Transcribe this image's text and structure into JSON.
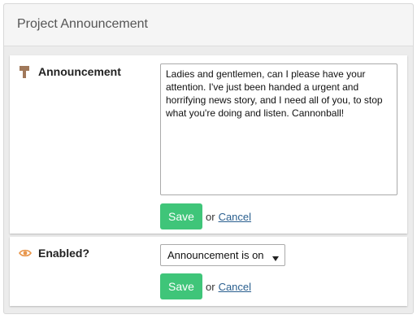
{
  "panel": {
    "title": "Project Announcement"
  },
  "announcement": {
    "label": "Announcement",
    "icon": "signpost-icon",
    "icon_color": "#a0785a",
    "value": "Ladies and gentlemen, can I please have your attention. I've just been handed a urgent and horrifying news story, and I need all of you, to stop what you're doing and listen. Cannonball!",
    "save_label": "Save",
    "or_text": "or",
    "cancel_label": "Cancel"
  },
  "enabled": {
    "label": "Enabled?",
    "icon": "eye-icon",
    "icon_color": "#e8954a",
    "selected": "Announcement is on",
    "save_label": "Save",
    "or_text": "or",
    "cancel_label": "Cancel"
  },
  "colors": {
    "save_button": "#3fc579",
    "link": "#2a5f8f"
  }
}
